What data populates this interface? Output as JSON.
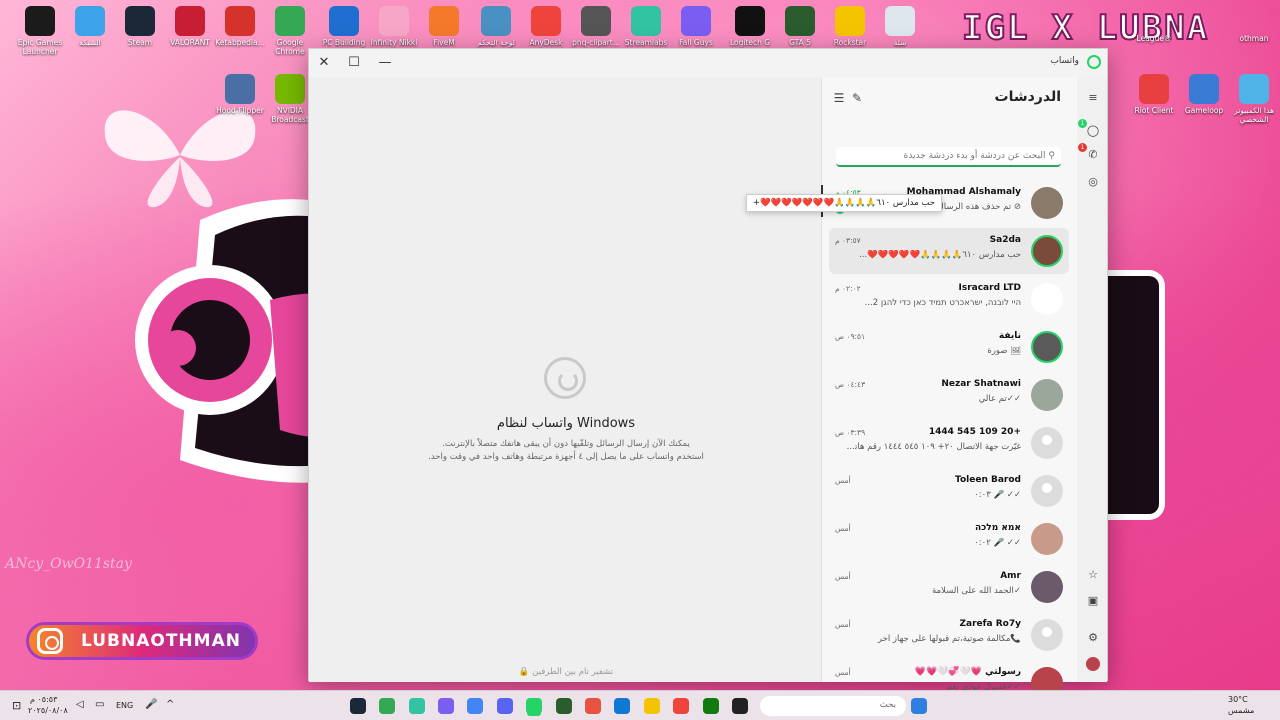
{
  "desktop": {
    "brand_title": "IGL X LUBNA",
    "watermark": "ANcy_OwO11stay",
    "instagram_handle": "LUBNAOTHMAN",
    "icons": [
      {
        "label": "Epic Games Launcher",
        "color": "#1b1b1b"
      },
      {
        "label": "الشبكة",
        "color": "#3da3e8"
      },
      {
        "label": "Steam",
        "color": "#1b2838"
      },
      {
        "label": "VALORANT",
        "color": "#c81e34"
      },
      {
        "label": "Ketabpedia...",
        "color": "#d6322c"
      },
      {
        "label": "Google Chrome",
        "color": "#34a853"
      },
      {
        "label": "PC Building",
        "color": "#1f6fd0"
      },
      {
        "label": "Infinity Nikki",
        "color": "#f6a7c8"
      },
      {
        "label": "FiveM",
        "color": "#f4792b"
      },
      {
        "label": "لوحة التحكم",
        "color": "#4a90c2"
      },
      {
        "label": "AnyDesk",
        "color": "#ef443b"
      },
      {
        "label": "pnq-clipart...",
        "color": "#555555"
      },
      {
        "label": "Streamlabs",
        "color": "#31c3a2"
      },
      {
        "label": "Fall Guys",
        "color": "#7a5ef2"
      },
      {
        "label": "Logitech G",
        "color": "#111111"
      },
      {
        "label": "GTA 5",
        "color": "#2a5c2e"
      },
      {
        "label": "Rockstar",
        "color": "#f5c400"
      },
      {
        "label": "سلة",
        "color": "#dfe7ee"
      }
    ],
    "icons_row2": [
      {
        "label": "Hood Flipper",
        "color": "#4a6fa5"
      },
      {
        "label": "NVIDIA Broadcast",
        "color": "#76b900"
      },
      {
        "label": "Riot Client",
        "color": "#e84040"
      },
      {
        "label": "Gameloop",
        "color": "#3a7bd5"
      },
      {
        "label": "هذا الكمبيوتر الشخصي",
        "color": "#4fb3e8"
      }
    ],
    "right_labels": [
      "League®",
      "othman"
    ]
  },
  "window": {
    "app_title": "واتساب",
    "controls": {
      "close": "✕",
      "maximize": "☐",
      "minimize": "—"
    }
  },
  "chat_list": {
    "title": "الدردشات",
    "search_placeholder": "البحث عن دردشة أو بدء دردشة جديدة",
    "tooltip": "حب مدارس ٦١٠🙏🙏🙏🙏❤️❤️❤️❤️❤️❤️❤️+",
    "chats": [
      {
        "name": "Mohammad Alshamaly",
        "preview": "⊘ تم حذف هذه الرسالة",
        "time": "٠٤:٥٣ م",
        "unread": "1",
        "avatar": "#8a7a6a"
      },
      {
        "name": "Sa2da",
        "preview": "حب مدارس ٦١٠🙏🙏🙏🙏❤️❤️❤️❤️❤️...",
        "time": "٠٣:٥٧ م",
        "unread": "",
        "avatar": "#7a4a3a"
      },
      {
        "name": "Isracard LTD",
        "preview": "היי לובנה, ישראכרט תמיד כאן כדי להגן 2...",
        "time": "٠٢:٠٢ م",
        "unread": "",
        "avatar": "#ffffff"
      },
      {
        "name": "نايفة",
        "preview": "🖼 صورة",
        "time": "٠٩:٥١ ص",
        "unread": "",
        "avatar": "#5a5a5a"
      },
      {
        "name": "Nezar Shatnawi",
        "preview": "✓✓تم عالي",
        "time": "٠٤:٤٣ ص",
        "unread": "",
        "avatar": "#9aa79a"
      },
      {
        "name": "+20 109 545 1444",
        "preview": "غيّرت جهة الاتصال ٢٠+ ١٠٩ ٥٤٥ ١٤٤٤ رقم هاتـ...",
        "time": "٠٣:٣٩ ص",
        "unread": "",
        "avatar": "placeholder"
      },
      {
        "name": "Toleen Barod",
        "preview": "✓✓ 🎤 ٠:٠٣",
        "time": "أمس",
        "unread": "",
        "avatar": "placeholder"
      },
      {
        "name": "אמא מלכה",
        "preview": "✓✓ 🎤 ٠:٠٢",
        "time": "أمس",
        "unread": "",
        "avatar": "#c89a8a"
      },
      {
        "name": "Amr",
        "preview": "✓الحمد الله على السلامة",
        "time": "أمس",
        "unread": "",
        "avatar": "#6a5a6a"
      },
      {
        "name": "Zarefa Ro7y",
        "preview": "📞مكالمة صوتية،تم قبولها على جهاز آخر",
        "time": "أمس",
        "unread": "",
        "avatar": "placeholder"
      },
      {
        "name": "رسولتي 💗🤍💞🤍💗💗",
        "preview": "✓✓غسول عودي بغيز",
        "time": "أمس",
        "unread": "",
        "avatar": "#b8434a"
      }
    ]
  },
  "main": {
    "title": "واتساب لنظام Windows",
    "subtitle_line1": "يمكنك الآن إرسال الرسائل وتلقّيها دون أن يبقى هاتفك متصلاً بالإنترنت.",
    "subtitle_line2": "استخدم واتساب على ما يصل إلى ٤ أجهزة مرتبطة وهاتف واحد في وقت واحد.",
    "encryption_note": "🔒 تشفير تام بين الطرفين"
  },
  "taskbar": {
    "clock_time": "٠٥:٥٣ م",
    "clock_date": "٢٠٢٥/٠٨/٠٨",
    "lang": "ENG",
    "search_placeholder": "بحث",
    "weather_temp": "30°C",
    "weather_desc": "مشمس"
  },
  "colors": {
    "accent": "#25d366",
    "window_bg": "#f3f3f3",
    "desktop_pink": "#e94596"
  }
}
